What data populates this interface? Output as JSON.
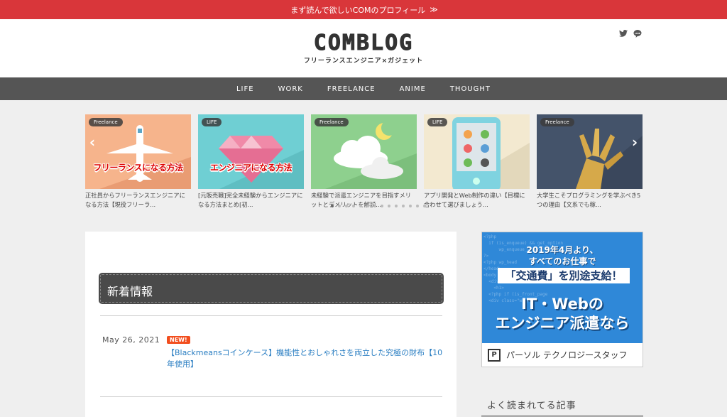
{
  "topbar": {
    "text": "まず読んで欲しいCOMのプロフィール",
    "arrow": "≫"
  },
  "header": {
    "logo": "COMBLOG",
    "tagline": "フリーランスエンジニア×ガジェット",
    "social": [
      {
        "icon": "twitter-icon"
      },
      {
        "icon": "line-icon"
      }
    ]
  },
  "nav": {
    "items": [
      "LIFE",
      "WORK",
      "FREELANCE",
      "ANIME",
      "THOUGHT"
    ]
  },
  "carousel": {
    "prev": "‹",
    "next": "›",
    "cards": [
      {
        "tag": "Freelance",
        "title": "正社員からフリーランスエンジニアになる方法【現役フリーラ...",
        "overlay": "フリーランスになる方法",
        "bg": "#f6b48c"
      },
      {
        "tag": "LIFE",
        "title": "[元販売職]完全未経験からエンジニアになる方法まとめ[初...",
        "overlay": "エンジニアになる方法",
        "bg": "#6fcfd3"
      },
      {
        "tag": "Freelance",
        "title": "未経験で派遣エンジニアを目指すメリットとデメリットを解説...",
        "overlay": "",
        "bg": "#8ed08e"
      },
      {
        "tag": "LIFE",
        "title": "アプリ開発とWeb制作の違い【目標に合わせて選びましょう...",
        "overlay": "",
        "bg": "#f3e9d0"
      },
      {
        "tag": "Freelance",
        "title": "大学生こそプログラミングを学ぶべき5つの理由【文系でも稼...",
        "overlay": "",
        "bg": "#44536a"
      }
    ]
  },
  "main": {
    "section_title": "新着情報",
    "posts": [
      {
        "date": "May 26, 2021",
        "badge": "NEW!",
        "title": "【Blackmeansコインケース】機能性とおしゃれさを両立した究極の財布【10年使用】"
      }
    ]
  },
  "ad": {
    "line1": "2019年4月より、",
    "line2": "すべてのお仕事で",
    "highlight": "「交通費」を別途支給！",
    "big1": "IT・Webの",
    "big2": "エンジニア派遣なら",
    "brand": "パーソル テクノロジースタッフ",
    "brand_mark": "P"
  },
  "sidebar": {
    "popular_title": "よく読まれてる記事"
  }
}
